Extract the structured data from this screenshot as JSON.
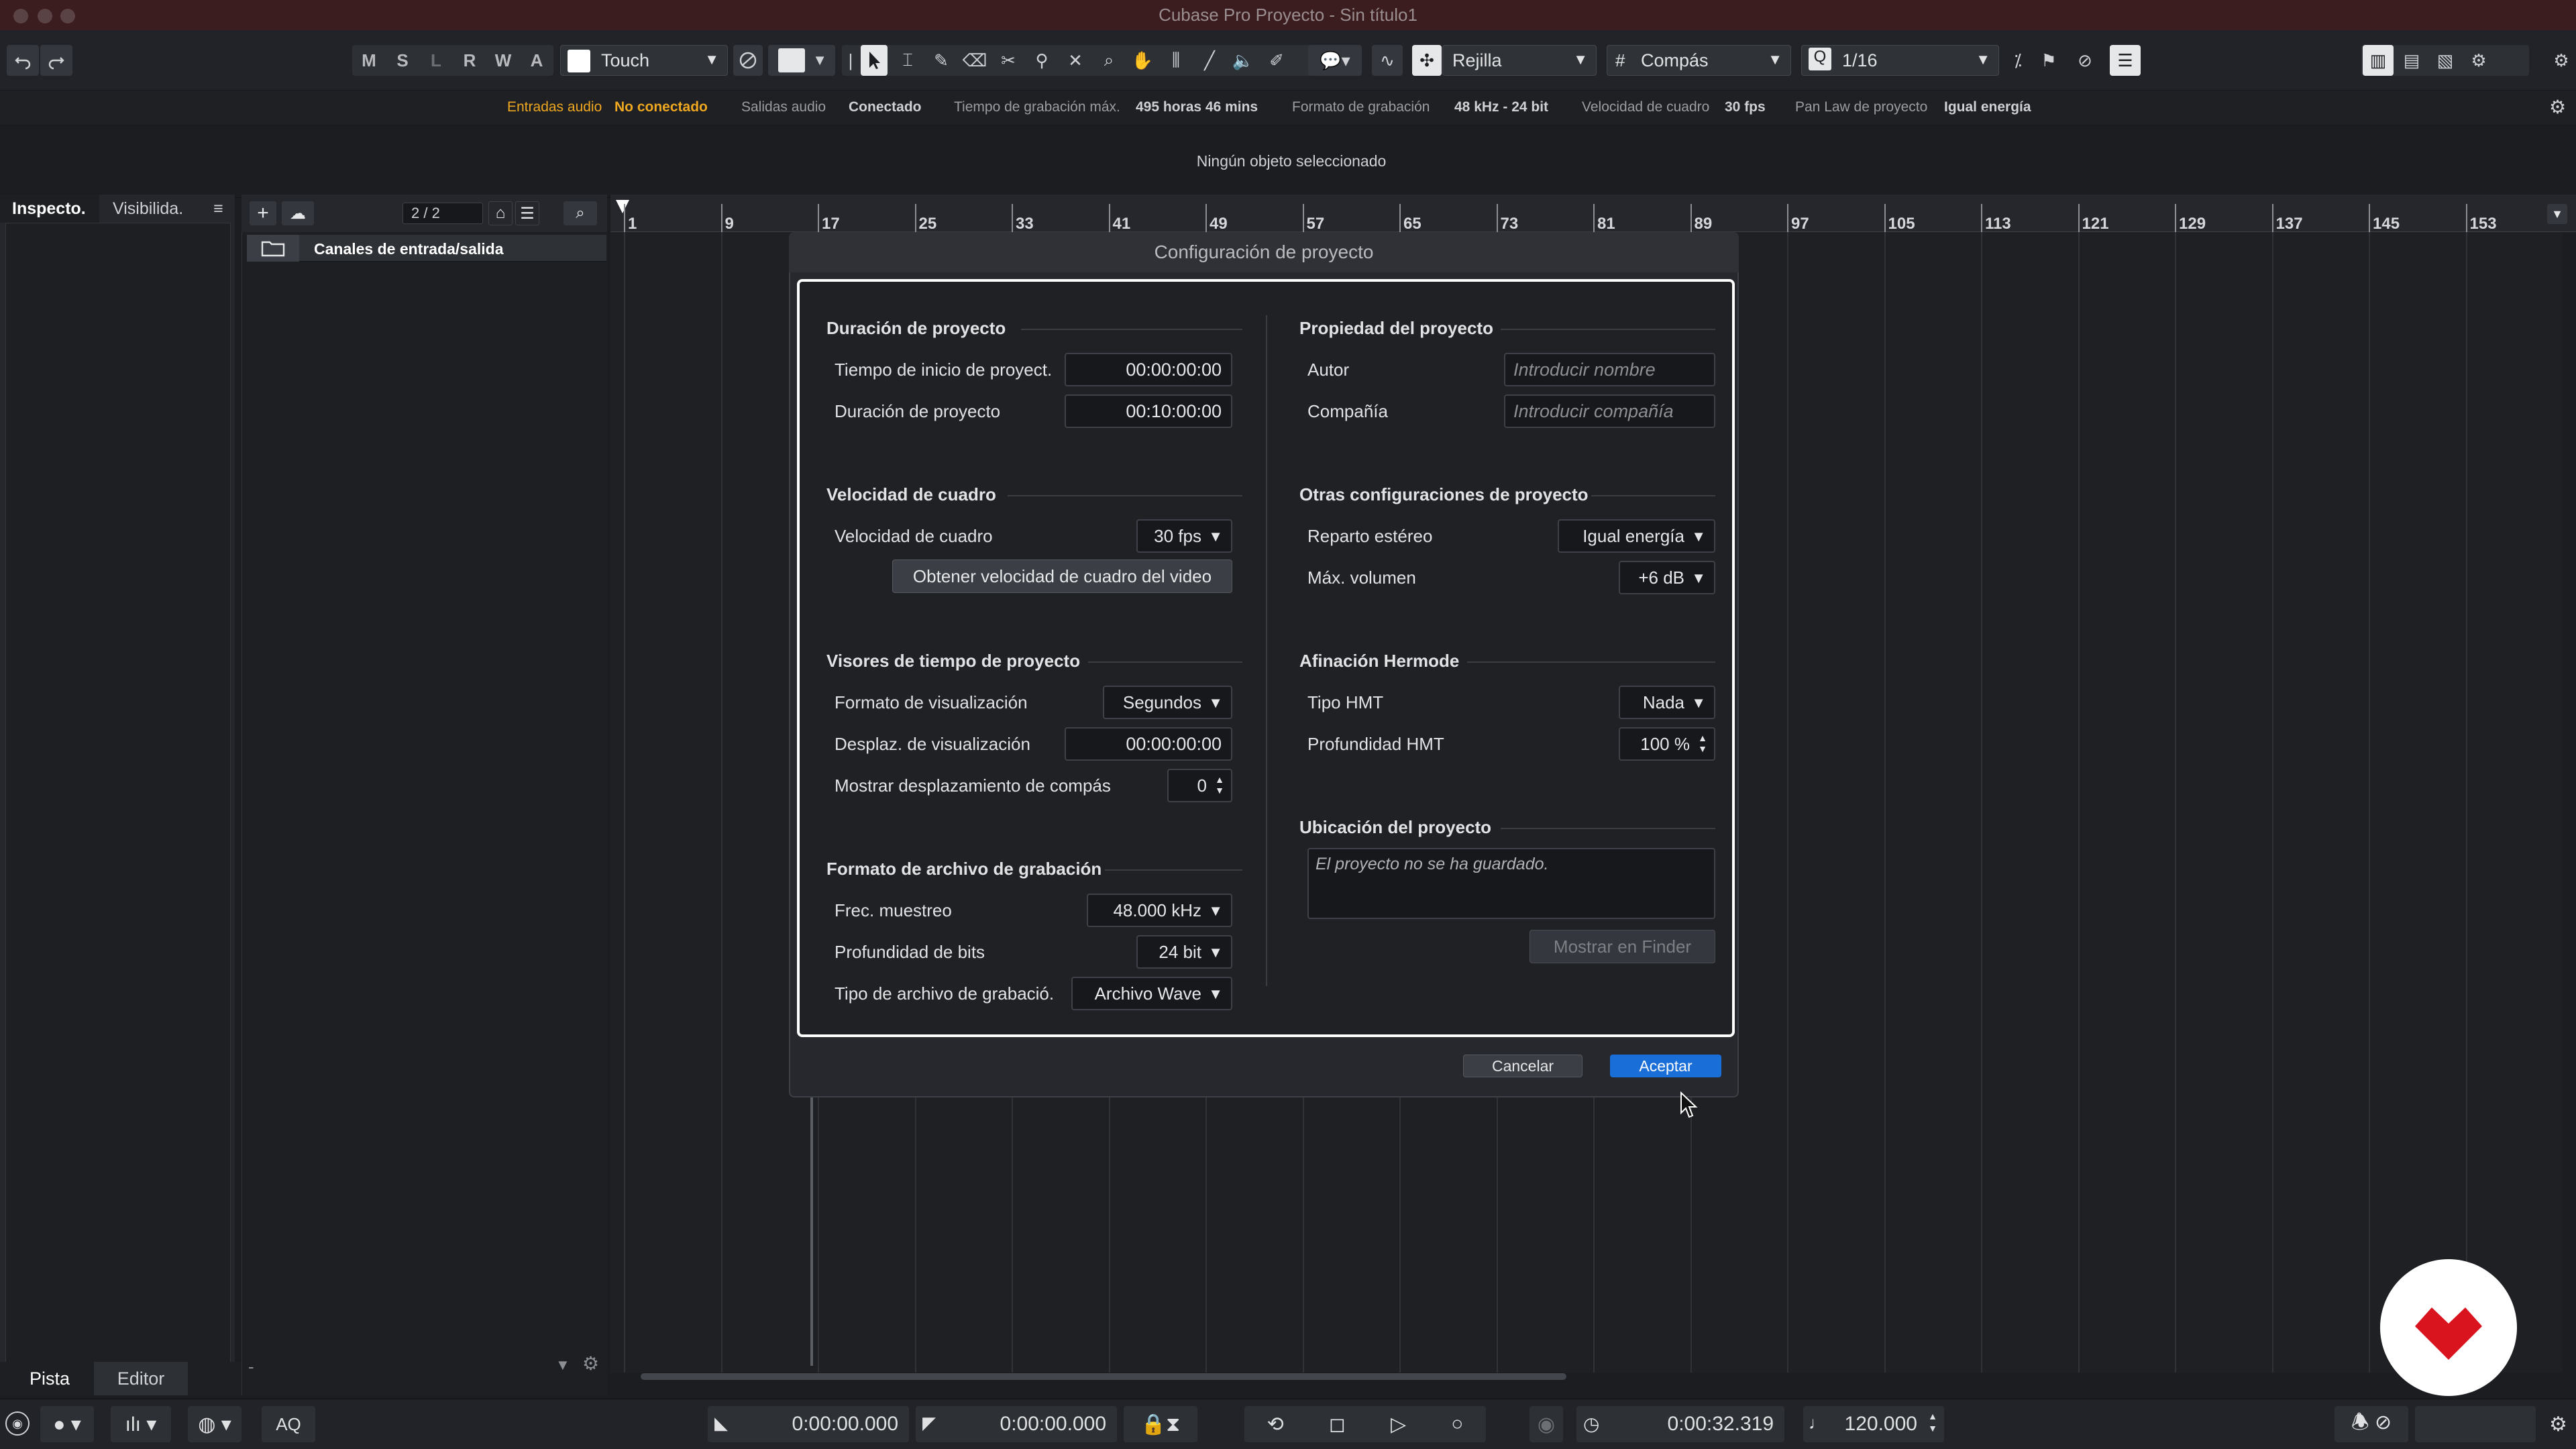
{
  "window": {
    "title": "Cubase Pro Proyecto - Sin título1"
  },
  "toolbar": {
    "mode_letters": [
      "M",
      "S",
      "L",
      "R",
      "W",
      "A"
    ],
    "automation_mode": "Touch",
    "snap_type": "Rejilla",
    "grid_type": "Compás",
    "quantize_value": "1/16"
  },
  "status": {
    "audio_inputs_label": "Entradas audio",
    "audio_inputs_value": "No conectado",
    "audio_outputs_label": "Salidas audio",
    "audio_outputs_value": "Conectado",
    "max_rec_time_label": "Tiempo de grabación máx.",
    "max_rec_time_value": "495 horas 46 mins",
    "rec_format_label": "Formato de grabación",
    "rec_format_value": "48 kHz - 24 bit",
    "frame_rate_label": "Velocidad de cuadro",
    "frame_rate_value": "30 fps",
    "pan_law_label": "Pan Law de proyecto",
    "pan_law_value": "Igual energía"
  },
  "info_line": "Ningún objeto seleccionado",
  "left_panel": {
    "tab_inspector": "Inspecto.",
    "tab_visibility": "Visibilida.",
    "bottom_tab_track": "Pista",
    "bottom_tab_editor": "Editor"
  },
  "track_list": {
    "counter": "2 / 2",
    "folder_track_name": "Canales de entrada/salida"
  },
  "ruler": {
    "labels": [
      "1",
      "9",
      "17",
      "25",
      "33",
      "41",
      "49",
      "57",
      "65",
      "73",
      "81",
      "89",
      "97",
      "105",
      "113",
      "121",
      "129",
      "137",
      "145",
      "153"
    ]
  },
  "dialog": {
    "title": "Configuración de proyecto",
    "duration": {
      "heading": "Duración de proyecto",
      "start_label": "Tiempo de inicio de proyect.",
      "start_value": "00:00:00:00",
      "length_label": "Duración de proyecto",
      "length_value": "00:10:00:00"
    },
    "frame_rate": {
      "heading": "Velocidad de cuadro",
      "label": "Velocidad de cuadro",
      "value": "30 fps",
      "button": "Obtener velocidad de cuadro del video"
    },
    "time_display": {
      "heading": "Visores de tiempo de proyecto",
      "format_label": "Formato de visualización",
      "format_value": "Segundos",
      "offset_label": "Desplaz. de visualización",
      "offset_value": "00:00:00:00",
      "bar_offset_label": "Mostrar desplazamiento de compás",
      "bar_offset_value": "0"
    },
    "record_format": {
      "heading": "Formato de archivo de grabación",
      "rate_label": "Frec. muestreo",
      "rate_value": "48.000 kHz",
      "bits_label": "Profundidad de bits",
      "bits_value": "24 bit",
      "type_label": "Tipo de archivo de grabació.",
      "type_value": "Archivo Wave"
    },
    "properties": {
      "heading": "Propiedad del proyecto",
      "author_label": "Autor",
      "author_placeholder": "Introducir nombre",
      "company_label": "Compañía",
      "company_placeholder": "Introducir compañía"
    },
    "other": {
      "heading": "Otras configuraciones de proyecto",
      "stereo_label": "Reparto estéreo",
      "stereo_value": "Igual energía",
      "maxvol_label": "Máx. volumen",
      "maxvol_value": "+6 dB"
    },
    "hermode": {
      "heading": "Afinación Hermode",
      "type_label": "Tipo HMT",
      "type_value": "Nada",
      "depth_label": "Profundidad HMT",
      "depth_value": "100 %"
    },
    "location": {
      "heading": "Ubicación del proyecto",
      "text": "El proyecto no se ha guardado.",
      "finder_button": "Mostrar en Finder"
    },
    "cancel_button": "Cancelar",
    "ok_button": "Aceptar"
  },
  "transport": {
    "aq_label": "AQ",
    "left_locator": "0:00:00.000",
    "right_locator": "0:00:00.000",
    "time_display": "0:00:32.319",
    "tempo": "120.000"
  },
  "colors": {
    "accent_blue": "#1a6ed8",
    "warning_orange": "#f0a820",
    "logo_red": "#d9141e"
  }
}
